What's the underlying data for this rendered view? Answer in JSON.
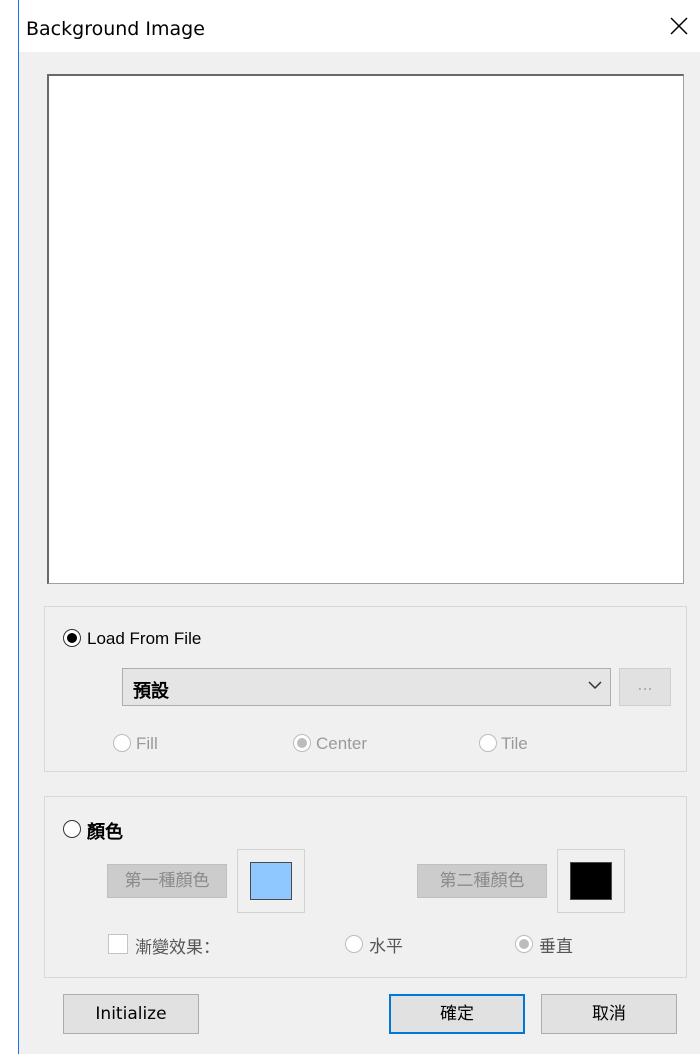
{
  "window": {
    "title": "Background Image"
  },
  "file_group": {
    "radio_label": "Load From File",
    "radio_checked": true,
    "combo_value": "預設",
    "browse_label": "...",
    "options": [
      {
        "label": "Fill",
        "checked": false
      },
      {
        "label": "Center",
        "checked": true
      },
      {
        "label": "Tile",
        "checked": false
      }
    ]
  },
  "color_group": {
    "radio_label": "顏色",
    "radio_checked": false,
    "first_color_label": "第一種顏色",
    "first_color": "#8ec8ff",
    "second_color_label": "第二種顏色",
    "second_color": "#000000",
    "gradient_label": "漸變效果：",
    "gradient_checked": false,
    "directions": [
      {
        "label": "水平",
        "checked": false
      },
      {
        "label": "垂直",
        "checked": true
      }
    ]
  },
  "buttons": {
    "initialize": "Initialize",
    "ok": "確定",
    "cancel": "取消"
  },
  "icons": {
    "close": "close-icon",
    "dropdown": "chevron-down-icon"
  }
}
